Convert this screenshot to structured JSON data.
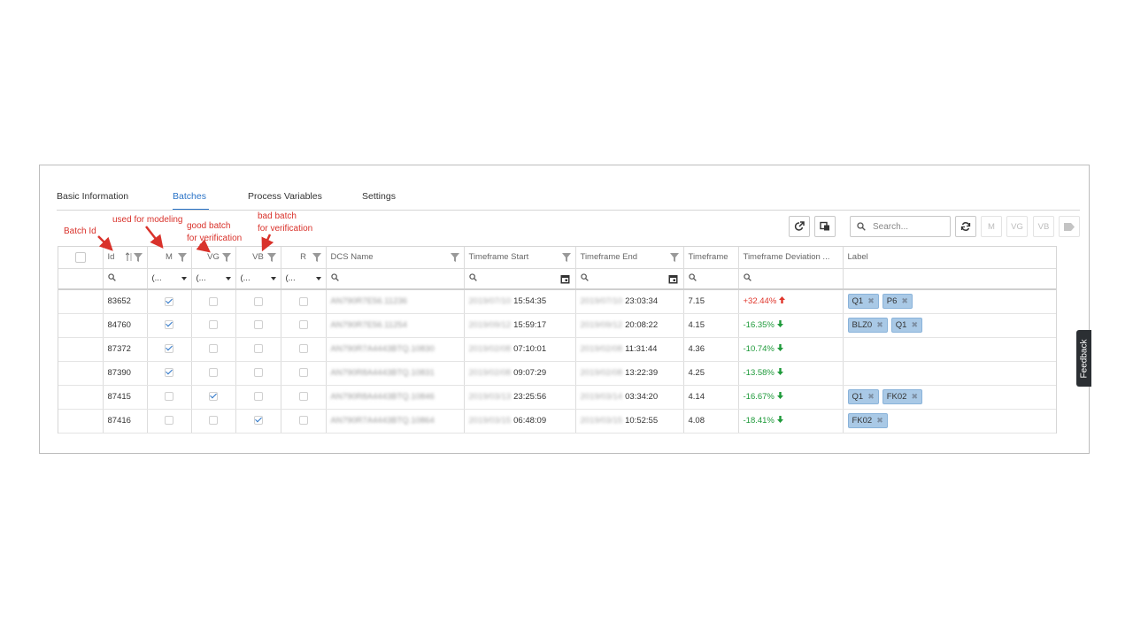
{
  "tabs": [
    {
      "label": "Basic Information"
    },
    {
      "label": "Batches"
    },
    {
      "label": "Process Variables"
    },
    {
      "label": "Settings"
    }
  ],
  "active_tab": "Batches",
  "annotations": {
    "batch_id": "Batch Id",
    "modeling": "used for modeling",
    "good_line1": "good batch",
    "good_line2": "for verification",
    "bad_line1": "bad batch",
    "bad_line2": "for verification"
  },
  "toolbar": {
    "search_placeholder": "Search...",
    "m_label": "M",
    "vg_label": "VG",
    "vb_label": "VB"
  },
  "columns": [
    "",
    "Id",
    "M",
    "VG",
    "VB",
    "R",
    "DCS Name",
    "Timeframe Start",
    "Timeframe End",
    "Timeframe",
    "Timeframe Deviation ...",
    "Label"
  ],
  "filter_placeholder": "(...",
  "rows": [
    {
      "id": "83652",
      "m": true,
      "vg": false,
      "vb": false,
      "r": false,
      "dcs": "AN790R7E56.11236",
      "start_date": "2019/07/10",
      "start_time": "15:54:35",
      "end_date": "2019/07/10",
      "end_time": "23:03:34",
      "tf": "7.15",
      "dev": "+32.44%",
      "dir": "up",
      "labels": [
        "Q1",
        "P6"
      ]
    },
    {
      "id": "84760",
      "m": true,
      "vg": false,
      "vb": false,
      "r": false,
      "dcs": "AN790R7E56.11254",
      "start_date": "2019/09/12",
      "start_time": "15:59:17",
      "end_date": "2019/09/12",
      "end_time": "20:08:22",
      "tf": "4.15",
      "dev": "-16.35%",
      "dir": "down",
      "labels": [
        "BLZ0",
        "Q1"
      ]
    },
    {
      "id": "87372",
      "m": true,
      "vg": false,
      "vb": false,
      "r": false,
      "dcs": "AN790R7A4443BTQ.10830",
      "start_date": "2019/02/08",
      "start_time": "07:10:01",
      "end_date": "2019/02/08",
      "end_time": "11:31:44",
      "tf": "4.36",
      "dev": "-10.74%",
      "dir": "down",
      "labels": []
    },
    {
      "id": "87390",
      "m": true,
      "vg": false,
      "vb": false,
      "r": false,
      "dcs": "AN790R8A4443BTQ.10831",
      "start_date": "2019/02/08",
      "start_time": "09:07:29",
      "end_date": "2019/02/08",
      "end_time": "13:22:39",
      "tf": "4.25",
      "dev": "-13.58%",
      "dir": "down",
      "labels": []
    },
    {
      "id": "87415",
      "m": false,
      "vg": true,
      "vb": false,
      "r": false,
      "dcs": "AN790R8A4443BTQ.10846",
      "start_date": "2019/03/13",
      "start_time": "23:25:56",
      "end_date": "2019/03/14",
      "end_time": "03:34:20",
      "tf": "4.14",
      "dev": "-16.67%",
      "dir": "down",
      "labels": [
        "Q1",
        "FK02"
      ]
    },
    {
      "id": "87416",
      "m": false,
      "vg": false,
      "vb": true,
      "r": false,
      "dcs": "AN790R7A4443BTQ.10864",
      "start_date": "2019/03/15",
      "start_time": "06:48:09",
      "end_date": "2019/03/15",
      "end_time": "10:52:55",
      "tf": "4.08",
      "dev": "-18.41%",
      "dir": "down",
      "labels": [
        "FK02"
      ]
    }
  ],
  "feedback_label": "Feedback",
  "colors": {
    "accent": "#2a73c7",
    "positive": "#e0352b",
    "negative": "#1e9a3a",
    "annotation": "#d9322b",
    "chip": "#a9c9e6"
  }
}
